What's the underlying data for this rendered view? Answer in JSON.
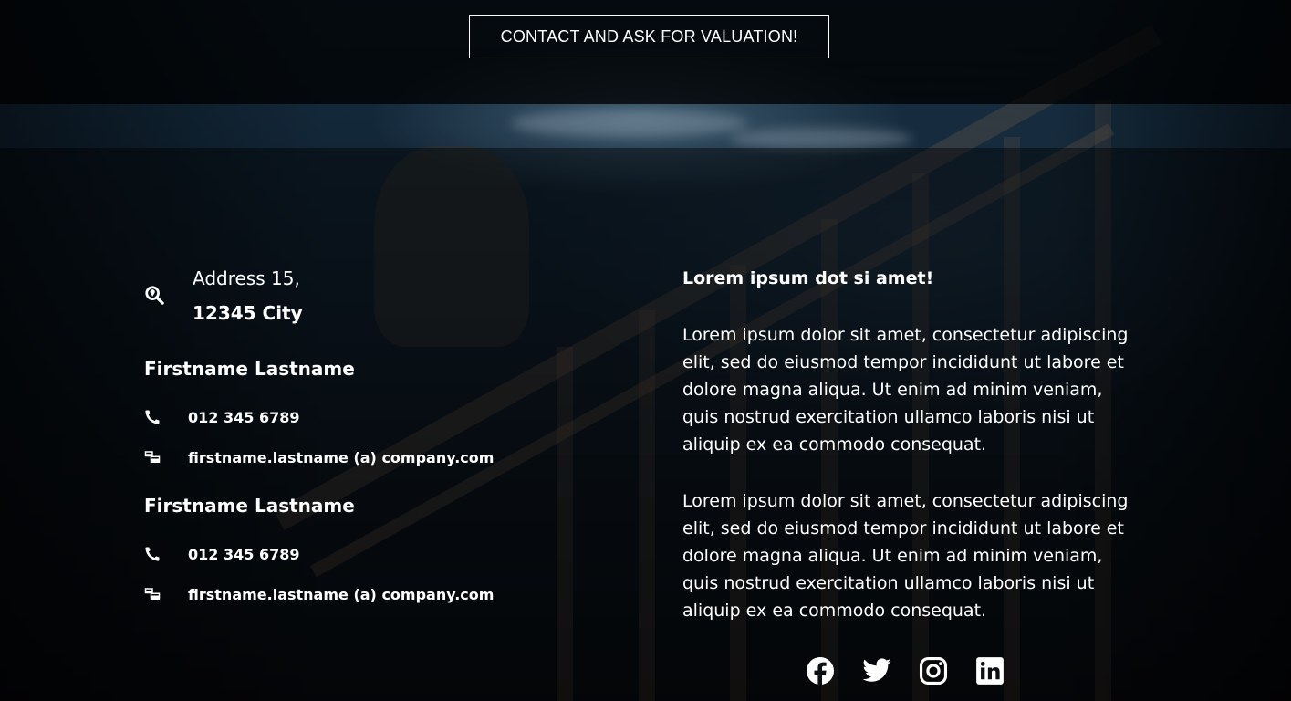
{
  "cta": {
    "button_label": "CONTACT AND ASK FOR VALUATION!"
  },
  "address": {
    "line1": "Address 15,",
    "line2": "12345 City",
    "icon": "search-location-icon"
  },
  "contacts": [
    {
      "name": "Firstname Lastname",
      "phone": "012 345 6789",
      "email": "firstname.lastname (a) company.com"
    },
    {
      "name": "Firstname Lastname",
      "phone": "012 345 6789",
      "email": "firstname.lastname (a) company.com"
    }
  ],
  "text": {
    "heading": "Lorem ipsum dot si amet!",
    "paragraphs": [
      "Lorem ipsum dolor sit amet, consectetur adipiscing elit, sed do eiusmod tempor incididunt ut labore et dolore magna aliqua. Ut enim ad minim veniam, quis nostrud exercitation ullamco laboris nisi ut aliquip ex ea commodo consequat.",
      "Lorem ipsum dolor sit amet, consectetur adipiscing elit, sed do eiusmod tempor incididunt ut labore et dolore magna aliqua. Ut enim ad minim veniam, quis nostrud exercitation ullamco laboris nisi ut aliquip ex ea commodo consequat."
    ]
  },
  "social": [
    "facebook-icon",
    "twitter-icon",
    "instagram-icon",
    "linkedin-icon"
  ],
  "colors": {
    "text": "#ffffff",
    "overlay": "#000000"
  }
}
